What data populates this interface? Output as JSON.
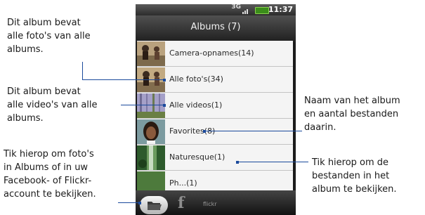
{
  "status_bar": {
    "network": "3G",
    "time": "11:37"
  },
  "header": {
    "title": "Albums (7)"
  },
  "albums": [
    {
      "label": "Camera-opnames",
      "count": "(14)"
    },
    {
      "label": "Alle foto's",
      "count": "(34)"
    },
    {
      "label": "Alle videos",
      "count": "(1)"
    },
    {
      "label": "Favorites",
      "count": "(8)"
    },
    {
      "label": "Naturesque",
      "count": "(1)"
    },
    {
      "label": "Ph...",
      "count": "(1)"
    }
  ],
  "bottom_tabs": {
    "facebook": "f",
    "flickr": "flickr"
  },
  "callouts": {
    "all_photos": [
      "Dit album bevat",
      "alle foto's van alle",
      "albums."
    ],
    "all_videos": [
      "Dit album bevat",
      "alle video's van alle",
      "albums."
    ],
    "accounts": [
      "Tik hierop om foto's",
      "in Albums of in uw",
      "Facebook- of Flickr-",
      "account te bekijken."
    ],
    "album_name": [
      "Naam van het album",
      "en aantal bestanden",
      "daarin."
    ],
    "tap_album": [
      "Tik hierop om de",
      "bestanden in het",
      "album te bekijken."
    ]
  },
  "colors": {
    "leader": "#1b4a9c",
    "list_bg": "#f2f2f2",
    "battery": "#3b8d1a"
  }
}
